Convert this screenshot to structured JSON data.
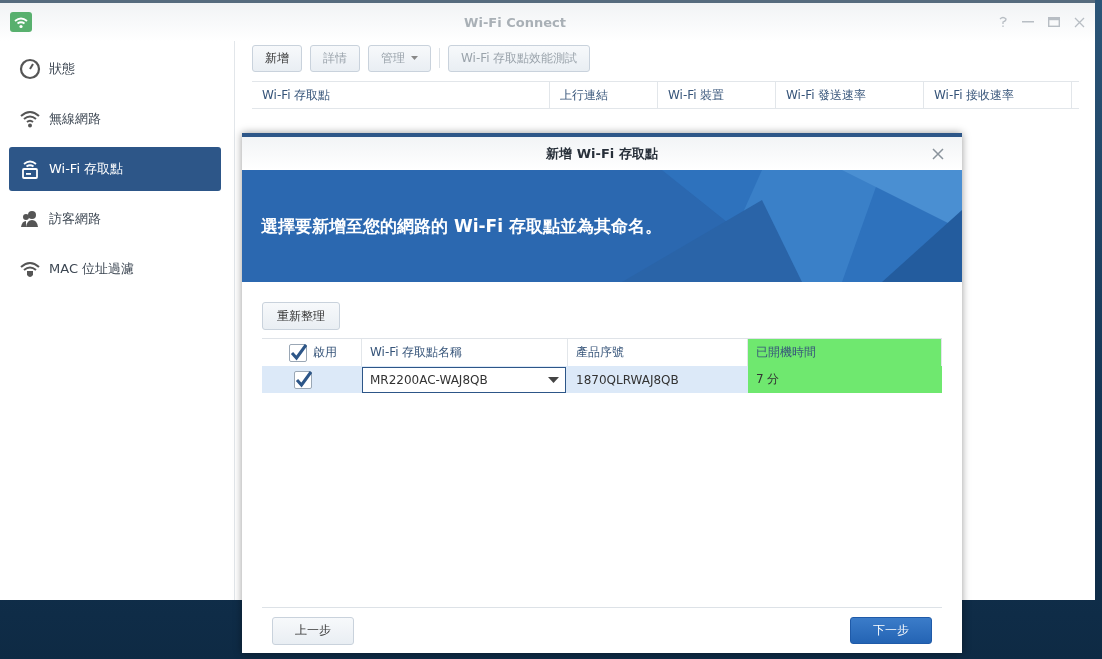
{
  "window": {
    "title": "Wi-Fi Connect"
  },
  "sidebar": {
    "items": [
      {
        "label": "狀態",
        "kind": "gauge",
        "selected": false
      },
      {
        "label": "無線網路",
        "kind": "wifi",
        "selected": false
      },
      {
        "label": "Wi-Fi 存取點",
        "kind": "router",
        "selected": true
      },
      {
        "label": "訪客網路",
        "kind": "guests",
        "selected": false
      },
      {
        "label": "MAC 位址過濾",
        "kind": "shield",
        "selected": false
      }
    ]
  },
  "toolbar": {
    "buttons": [
      {
        "label": "新增",
        "disabled": false,
        "dropdown": false
      },
      {
        "label": "詳情",
        "disabled": true,
        "dropdown": false
      },
      {
        "label": "管理",
        "disabled": true,
        "dropdown": true
      },
      {
        "label": "Wi-Fi 存取點效能測試",
        "disabled": true,
        "dropdown": false
      }
    ]
  },
  "table": {
    "columns": [
      "Wi-Fi 存取點",
      "上行連結",
      "Wi-Fi 裝置",
      "Wi-Fi 發送速率",
      "Wi-Fi 接收速率"
    ]
  },
  "dialog": {
    "title": "新增 Wi-Fi 存取點",
    "banner": "選擇要新增至您的網路的 **Wi-Fi** 存取點並為其命名。",
    "refresh_button": "重新整理",
    "table": {
      "columns": [
        {
          "label": "啟用",
          "checked": true,
          "highlighted": false
        },
        {
          "label": "Wi-Fi 存取點名稱",
          "highlighted": false
        },
        {
          "label": "產品序號",
          "highlighted": false
        },
        {
          "label": "已開機時間",
          "highlighted": true
        }
      ],
      "rows": [
        {
          "selected": true,
          "enabled": true,
          "name": "MR2200AC-WAJ8QB",
          "serial": "1870QLRWAJ8QB",
          "uptime": "7 分"
        }
      ]
    },
    "back_button": "上一步",
    "next_button": "下一步"
  }
}
